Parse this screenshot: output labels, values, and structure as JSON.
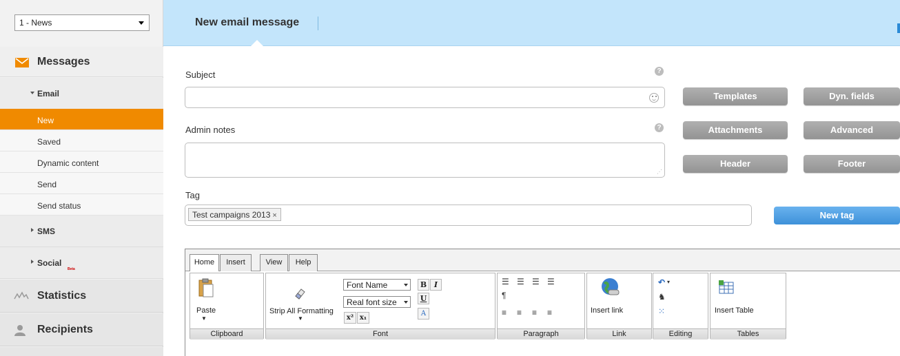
{
  "sidebar": {
    "list_select": "1 - News",
    "messages_title": "Messages",
    "email_label": "Email",
    "email_items": [
      "New",
      "Saved",
      "Dynamic content",
      "Send",
      "Send status"
    ],
    "sms_label": "SMS",
    "social_label": "Social",
    "social_badge": "Beta",
    "statistics_label": "Statistics",
    "recipients_label": "Recipients",
    "accent_color": "#f08a00"
  },
  "header": {
    "title": "New email message"
  },
  "form": {
    "subject_label": "Subject",
    "subject_value": "",
    "admin_notes_label": "Admin notes",
    "admin_notes_value": "",
    "tag_label": "Tag",
    "tag_chip": "Test campaigns 2013",
    "tag_remove": "×",
    "help_glyph": "?",
    "buttons": {
      "templates": "Templates",
      "dyn_fields": "Dyn. fields",
      "attachments": "Attachments",
      "advanced": "Advanced",
      "header": "Header",
      "footer": "Footer",
      "new_tag": "New tag"
    }
  },
  "editor": {
    "tabs": [
      "Home",
      "Insert",
      "View",
      "Help"
    ],
    "active_tab": "Home",
    "groups": {
      "clipboard": "Clipboard",
      "font": "Font",
      "paragraph": "Paragraph",
      "link": "Link",
      "editing": "Editing",
      "tables": "Tables"
    },
    "paste_label": "Paste",
    "strip_formatting_label": "Strip All Formatting",
    "font_name": "Font Name",
    "font_size": "Real font size",
    "bold": "B",
    "italic": "I",
    "underline": "U",
    "insert_link_label": "Insert link",
    "insert_table_label": "Insert Table"
  }
}
